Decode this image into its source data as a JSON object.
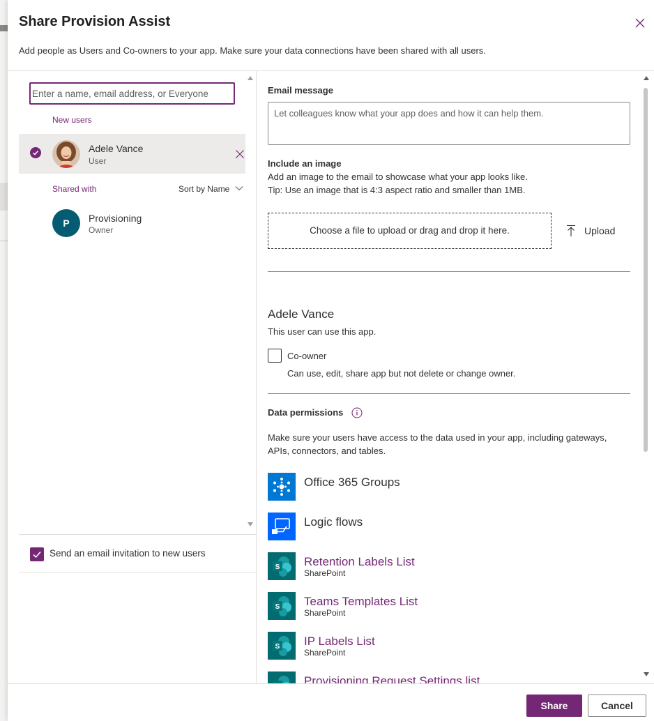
{
  "dialog": {
    "title": "Share Provision Assist",
    "subtitle": "Add people as Users and Co-owners to your app. Make sure your data connections have been shared with all users."
  },
  "left_panel": {
    "search_placeholder": "Enter a name, email address, or Everyone",
    "new_users_label": "New users",
    "new_user": {
      "name": "Adele Vance",
      "role": "User"
    },
    "shared_with_label": "Shared with",
    "sort_label": "Sort by Name",
    "shared_user": {
      "initial": "P",
      "name": "Provisioning",
      "role": "Owner"
    },
    "invite_label": "Send an email invitation to new users",
    "invite_checked": true
  },
  "right_panel": {
    "email_message_heading": "Email message",
    "email_placeholder": "Let colleagues know what your app does and how it can help them.",
    "include_image_heading": "Include an image",
    "include_image_desc": "Add an image to the email to showcase what your app looks like.",
    "include_image_tip": "Tip: Use an image that is 4:3 aspect ratio and smaller than 1MB.",
    "drop_zone_text": "Choose a file to upload or drag and drop it here.",
    "upload_label": "Upload",
    "selected_user_name": "Adele Vance",
    "selected_user_desc": "This user can use this app.",
    "coowner_label": "Co-owner",
    "coowner_desc": "Can use, edit, share app but not delete or change owner.",
    "coowner_checked": false,
    "data_permissions_heading": "Data permissions",
    "data_permissions_desc_line1": "Make sure your users have access to the data used in your app, including gateways,",
    "data_permissions_desc_line2": "APIs, connectors, and tables.",
    "data_sources": [
      {
        "name": "Office 365 Groups",
        "type": "",
        "icon": "office365-groups-icon",
        "color": "#0078d4"
      },
      {
        "name": "Logic flows",
        "type": "",
        "icon": "logic-flows-icon",
        "color": "#0066ff"
      },
      {
        "name": "Retention Labels List",
        "type": "SharePoint",
        "icon": "sharepoint-icon",
        "color": "#036c70"
      },
      {
        "name": "Teams Templates List",
        "type": "SharePoint",
        "icon": "sharepoint-icon",
        "color": "#036c70"
      },
      {
        "name": "IP Labels List",
        "type": "SharePoint",
        "icon": "sharepoint-icon",
        "color": "#036c70"
      },
      {
        "name": "Provisioning Request Settings list",
        "type": "",
        "icon": "sharepoint-icon",
        "color": "#036c70"
      }
    ]
  },
  "footer": {
    "share_label": "Share",
    "cancel_label": "Cancel"
  },
  "colors": {
    "accent": "#742774",
    "avatar_teal": "#035c71",
    "sharepoint_teal": "#036c70"
  }
}
